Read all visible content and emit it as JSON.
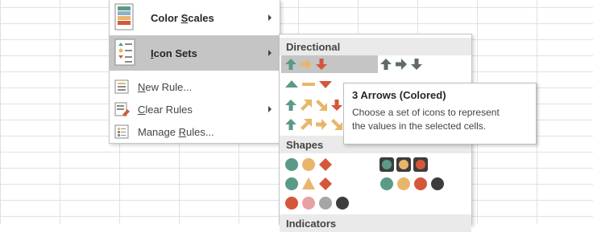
{
  "menu": {
    "items": [
      {
        "label_pre": "Color ",
        "accel": "S",
        "label_post": "cales",
        "icon": "color-scales-icon",
        "has_submenu": true
      },
      {
        "label_pre": "",
        "accel": "I",
        "label_post": "con Sets",
        "icon": "icon-sets-icon",
        "has_submenu": true
      },
      {
        "label_pre": "",
        "accel": "N",
        "label_post": "ew Rule...",
        "icon": "new-rule-icon",
        "has_submenu": false
      },
      {
        "label_pre": "",
        "accel": "C",
        "label_post": "lear Rules",
        "icon": "clear-rules-icon",
        "has_submenu": true
      },
      {
        "label_pre": "Manage ",
        "accel": "R",
        "label_post": "ules...",
        "icon": "manage-rules-icon",
        "has_submenu": false
      }
    ]
  },
  "submenu": {
    "sections": [
      "Directional",
      "Shapes",
      "Indicators"
    ]
  },
  "tooltip": {
    "title": "3 Arrows (Colored)",
    "description_line1": "Choose a set of icons to represent",
    "description_line2": "the values in the selected cells."
  },
  "colors": {
    "green": "#5a9a87",
    "yellow": "#e8b66b",
    "red": "#d5573b",
    "gray_arrow": "#5f6b6e",
    "pink": "#e8a1a1",
    "light_gray": "#a6a6a6",
    "dark": "#3d3d3d",
    "highlight": "#c5c5c5"
  }
}
